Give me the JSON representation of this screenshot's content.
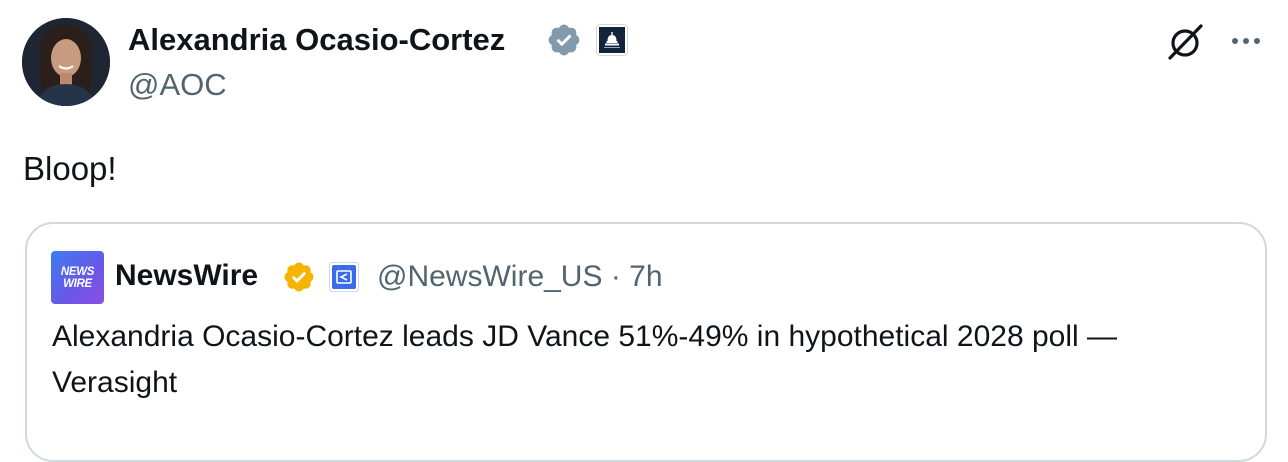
{
  "author": {
    "display_name": "Alexandria Ocasio-Cortez",
    "handle": "@AOC",
    "avatar_icon": "profile-photo",
    "verified_badge_color": "#829aab",
    "affiliate_icon": "capitol-dome-icon"
  },
  "tweet": {
    "text": "Bloop!"
  },
  "header_actions": {
    "grok_icon": "grok-icon",
    "more_icon": "more-horizontal-icon"
  },
  "quote": {
    "avatar_line1": "NEWS",
    "avatar_line2": "WIRE",
    "display_name": "NewsWire",
    "verified_badge_color": "#f4b400",
    "affiliate_icon": "newswire-affiliate-icon",
    "handle": "@NewsWire_US",
    "separator": "·",
    "time": "7h",
    "text": "Alexandria Ocasio-Cortez leads JD Vance 51%-49% in hypothetical 2028 poll — Verasight"
  },
  "colors": {
    "text_primary": "#0f1419",
    "text_secondary": "#536471",
    "border": "#cfd9de"
  }
}
